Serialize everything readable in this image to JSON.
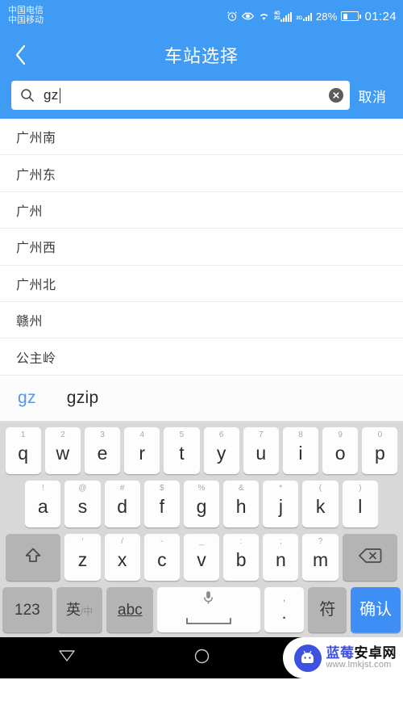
{
  "status_bar": {
    "carrier_primary": "中国电信",
    "carrier_secondary": "中国移动",
    "icons": [
      "alarm-icon",
      "eye-icon",
      "wifi-icon",
      "signal-4g-2g-icon",
      "signal-2g-icon"
    ],
    "signal_primary_label_top": "4G",
    "signal_primary_label_bottom": "2G",
    "signal_secondary_label": "2G",
    "battery_percent": "28%",
    "time": "01:24"
  },
  "header": {
    "title": "车站选择",
    "back_icon": "chevron-left-icon",
    "accent_color": "#3f9bf3"
  },
  "search": {
    "value": "gz",
    "placeholder": "",
    "search_icon": "search-icon",
    "clear_icon": "clear-circle-icon",
    "cancel_label": "取消"
  },
  "results": [
    {
      "name": "广州南"
    },
    {
      "name": "广州东"
    },
    {
      "name": "广州"
    },
    {
      "name": "广州西"
    },
    {
      "name": "广州北"
    },
    {
      "name": "赣州"
    },
    {
      "name": "公主岭"
    }
  ],
  "candidates": [
    {
      "text": "gz",
      "selected": true
    },
    {
      "text": "gzip",
      "selected": false
    }
  ],
  "keyboard": {
    "row1": [
      {
        "main": "q",
        "hint": "1"
      },
      {
        "main": "w",
        "hint": "2"
      },
      {
        "main": "e",
        "hint": "3"
      },
      {
        "main": "r",
        "hint": "4"
      },
      {
        "main": "t",
        "hint": "5"
      },
      {
        "main": "y",
        "hint": "6"
      },
      {
        "main": "u",
        "hint": "7"
      },
      {
        "main": "i",
        "hint": "8"
      },
      {
        "main": "o",
        "hint": "9"
      },
      {
        "main": "p",
        "hint": "0"
      }
    ],
    "row2": [
      {
        "main": "a",
        "hint": "!"
      },
      {
        "main": "s",
        "hint": "@"
      },
      {
        "main": "d",
        "hint": "#"
      },
      {
        "main": "f",
        "hint": "$"
      },
      {
        "main": "g",
        "hint": "%"
      },
      {
        "main": "h",
        "hint": "&"
      },
      {
        "main": "j",
        "hint": "*"
      },
      {
        "main": "k",
        "hint": "("
      },
      {
        "main": "l",
        "hint": ")"
      }
    ],
    "row3": [
      {
        "main": "z",
        "hint": "'"
      },
      {
        "main": "x",
        "hint": "/"
      },
      {
        "main": "c",
        "hint": "-"
      },
      {
        "main": "v",
        "hint": "_"
      },
      {
        "main": "b",
        "hint": ":"
      },
      {
        "main": "n",
        "hint": ";"
      },
      {
        "main": "m",
        "hint": "?"
      }
    ],
    "shift_icon": "shift-arrow-icon",
    "backspace_icon": "backspace-icon",
    "row4": {
      "numbers_label": "123",
      "lang_label_main": "英",
      "lang_label_sub": "/中",
      "abc_label": "abc",
      "space_icon": "microphone-icon",
      "punct_hint": ",",
      "punct_label": ".",
      "symbols_label": "符",
      "enter_label": "确认",
      "enter_color": "#3f8ef5"
    }
  },
  "nav_bar": {
    "back_icon": "nav-back-triangle-icon",
    "home_icon": "nav-home-circle-icon",
    "watermark_cn_blue": "蓝莓",
    "watermark_cn_black": "安卓网",
    "watermark_url": "www.lmkjst.com",
    "watermark_logo_icon": "android-robot-icon"
  }
}
